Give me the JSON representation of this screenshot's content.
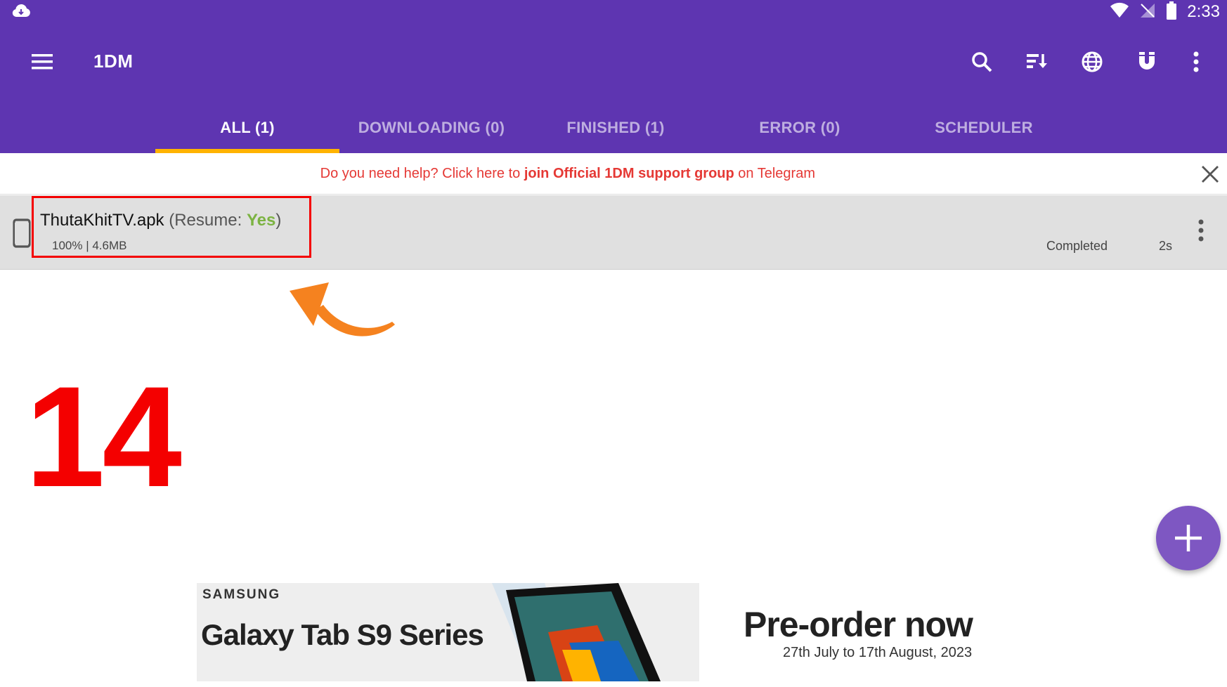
{
  "status_bar": {
    "time": "2:33"
  },
  "toolbar": {
    "title": "1DM",
    "menu_icon": "hamburger-menu-icon",
    "actions": [
      "search-icon",
      "sort-icon",
      "globe-icon",
      "magnet-icon",
      "more-vert-icon"
    ]
  },
  "tabs": [
    {
      "label": "ALL (1)",
      "active": true
    },
    {
      "label": "DOWNLOADING (0)",
      "active": false
    },
    {
      "label": "FINISHED (1)",
      "active": false
    },
    {
      "label": "ERROR (0)",
      "active": false
    },
    {
      "label": "SCHEDULER",
      "active": false
    }
  ],
  "help_banner": {
    "prefix": "Do you need help? Click here to ",
    "link": "join Official 1DM support group",
    "suffix": " on Telegram"
  },
  "download": {
    "filename": "ThutaKhitTV.apk",
    "resume_label": "(Resume: ",
    "resume_value": "Yes",
    "resume_close": ")",
    "progress": "100% | 4.6MB",
    "status": "Completed",
    "duration": "2s"
  },
  "annotation": {
    "step": "14"
  },
  "ad": {
    "brand": "SAMSUNG",
    "product": "Galaxy Tab S9 Series",
    "cta": "Pre-order now",
    "dates": "27th July to 17th August, 2023"
  },
  "colors": {
    "primary": "#5e35b1",
    "indicator": "#ffb300",
    "help_text": "#e53935",
    "resume_yes": "#7cb342",
    "annotation_red": "#f40000",
    "arrow_orange": "#f5821f",
    "fab": "#7e57c2"
  }
}
